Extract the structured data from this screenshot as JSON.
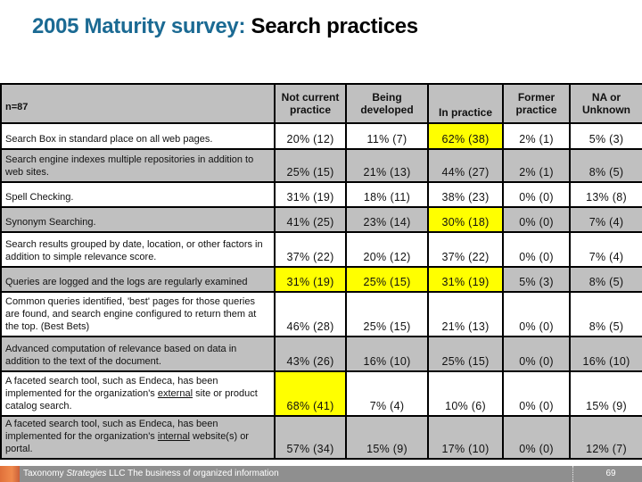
{
  "title": {
    "accent": "2005 Maturity survey:",
    "rest": " Search practices"
  },
  "table": {
    "sample_label": "n=87",
    "columns": [
      "Not  current practice",
      "Being developed",
      "In practice",
      "Former practice",
      "NA or Unknown"
    ],
    "highlight_color": "#ffff00",
    "rows": [
      {
        "label_pre": "Search Box in standard place on all web pages.",
        "label_u": "",
        "label_post": "",
        "values": [
          "20%  (12)",
          "11%  (7)",
          "62%  (38)",
          "2%  (1)",
          "5%  (3)"
        ]
      },
      {
        "label_pre": "Search engine indexes multiple repositories in addition to web sites.",
        "label_u": "",
        "label_post": "",
        "values": [
          "25%  (15)",
          "21%  (13)",
          "44%  (27)",
          "2%  (1)",
          "8%  (5)"
        ]
      },
      {
        "label_pre": "Spell Checking.",
        "label_u": "",
        "label_post": "",
        "values": [
          "31%  (19)",
          "18%  (11)",
          "38%  (23)",
          "0%  (0)",
          "13%  (8)"
        ]
      },
      {
        "label_pre": "Synonym Searching.",
        "label_u": "",
        "label_post": "",
        "values": [
          "41%  (25)",
          "23%  (14)",
          "30%  (18)",
          "0%  (0)",
          "7%  (4)"
        ]
      },
      {
        "label_pre": "Search results grouped by date, location, or other factors in addition to simple relevance score.",
        "label_u": "",
        "label_post": "",
        "values": [
          "37%  (22)",
          "20%  (12)",
          "37%  (22)",
          "0%  (0)",
          "7%  (4)"
        ]
      },
      {
        "label_pre": "Queries are logged and the logs are regularly examined",
        "label_u": "",
        "label_post": "",
        "values": [
          "31%  (19)",
          "25%  (15)",
          "31%  (19)",
          "5%  (3)",
          "8%  (5)"
        ]
      },
      {
        "label_pre": "Common queries identified, 'best' pages for those queries are found, and search engine configured to return them at the top. (Best Bets)",
        "label_u": "",
        "label_post": "",
        "values": [
          "46%  (28)",
          "25%  (15)",
          "21%  (13)",
          "0%  (0)",
          "8%  (5)"
        ]
      },
      {
        "label_pre": "Advanced computation of relevance based on data in addition to the text of the document.",
        "label_u": "",
        "label_post": "",
        "values": [
          "43%  (26)",
          "16%  (10)",
          "25%  (15)",
          "0%  (0)",
          "16%  (10)"
        ]
      },
      {
        "label_pre": "A faceted search tool, such as Endeca, has been implemented for the organization's ",
        "label_u": "external",
        "label_post": " site or product catalog search.",
        "values": [
          "68%  (41)",
          "7%  (4)",
          "10%  (6)",
          "0%  (0)",
          "15%  (9)"
        ]
      },
      {
        "label_pre": "A faceted search tool, such as Endeca, has been implemented for the organization's ",
        "label_u": "internal",
        "label_post": " website(s) or portal.",
        "values": [
          "57%  (34)",
          "15%  (9)",
          "17%  (10)",
          "0%  (0)",
          "12%  (7)"
        ]
      }
    ]
  },
  "footer": {
    "company_pre": "Taxonomy ",
    "company_italic": "Strategies",
    "company_post": " LLC   The business of organized information",
    "page_number": "69"
  }
}
